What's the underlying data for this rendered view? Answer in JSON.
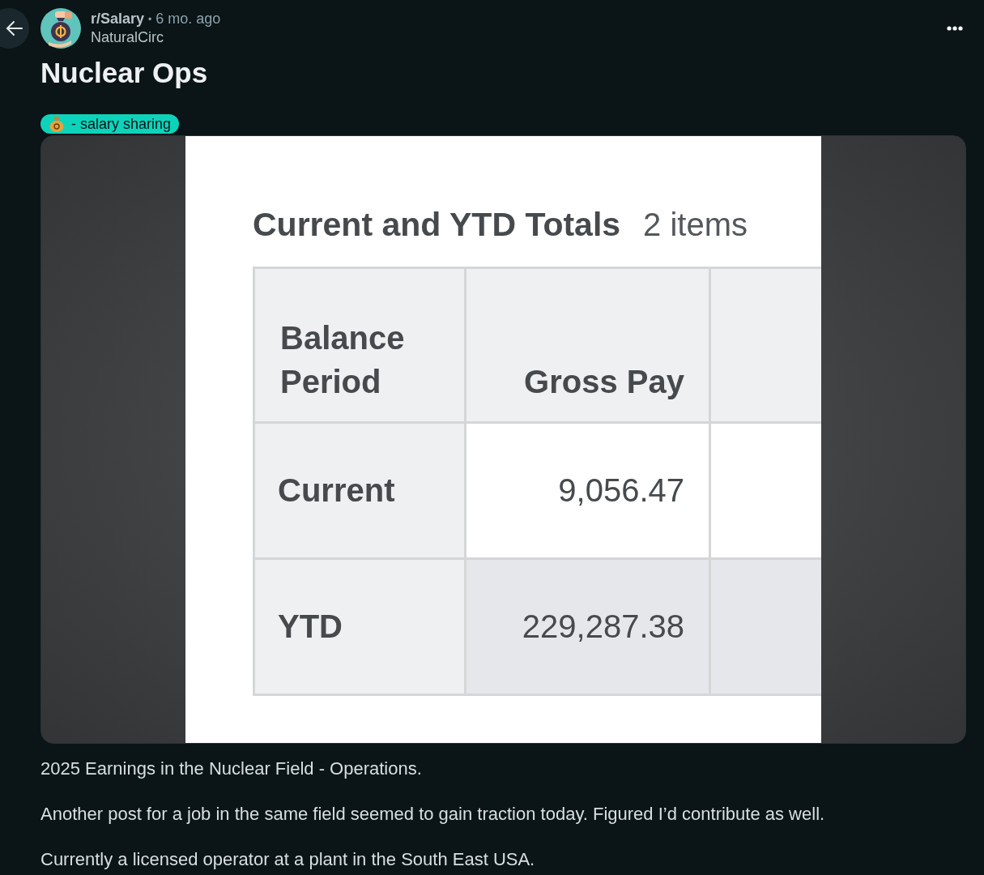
{
  "post": {
    "subreddit": "r/Salary",
    "separator": "•",
    "age": "6 mo. ago",
    "author": "NaturalCirc",
    "title": "Nuclear Ops",
    "flair": {
      "label": "- salary sharing"
    }
  },
  "image": {
    "title": "Current and YTD Totals",
    "count": "2 items",
    "columns": [
      "Balance Period",
      "Gross Pay"
    ],
    "rows": [
      {
        "cells": [
          "Current",
          "9,056.47"
        ],
        "highlighted": false
      },
      {
        "cells": [
          "YTD",
          "229,287.38"
        ],
        "highlighted": true
      }
    ]
  },
  "body": [
    "2025 Earnings in the Nuclear Field - Operations.",
    "Another post for a job in the same field seemed to gain traction today. Figured I’d contribute as well.",
    "Currently a licensed operator at a plant in the South East USA."
  ]
}
